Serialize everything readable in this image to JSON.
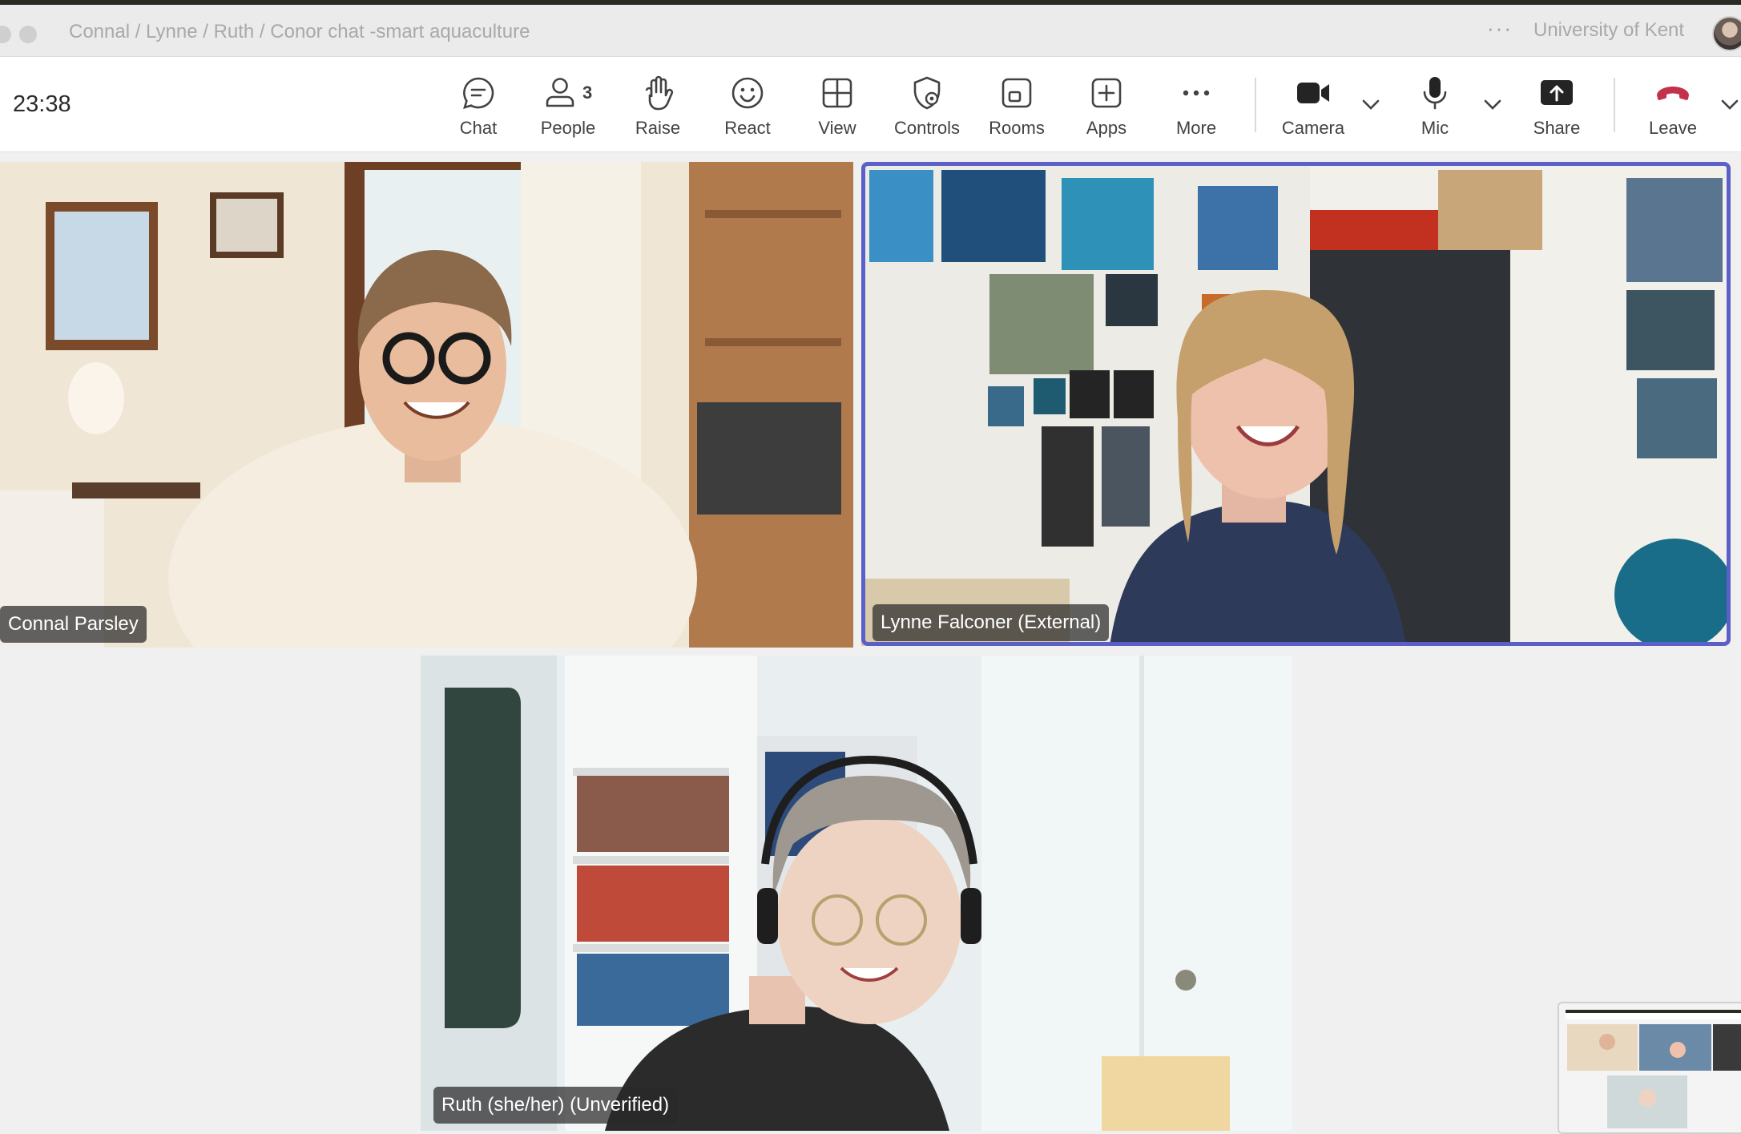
{
  "window": {
    "title": "Connal / Lynne / Ruth / Conor chat -smart aquaculture",
    "more_icon": "more-horizontal-icon",
    "organization": "University of Kent"
  },
  "toolbar": {
    "timer": "23:38",
    "buttons": {
      "chat": {
        "label": "Chat",
        "icon": "chat-bubble-icon"
      },
      "people": {
        "label": "People",
        "count": "3",
        "icon": "person-icon"
      },
      "raise": {
        "label": "Raise",
        "icon": "raise-hand-icon"
      },
      "react": {
        "label": "React",
        "icon": "smiley-icon"
      },
      "view": {
        "label": "View",
        "icon": "grid-view-icon"
      },
      "controls": {
        "label": "Controls",
        "icon": "shield-gear-icon"
      },
      "rooms": {
        "label": "Rooms",
        "icon": "breakout-rooms-icon"
      },
      "apps": {
        "label": "Apps",
        "icon": "add-app-icon"
      },
      "more": {
        "label": "More",
        "icon": "more-horizontal-icon"
      },
      "camera": {
        "label": "Camera",
        "icon": "video-camera-icon"
      },
      "mic": {
        "label": "Mic",
        "icon": "microphone-icon"
      },
      "share": {
        "label": "Share",
        "icon": "share-screen-icon"
      },
      "leave": {
        "label": "Leave",
        "icon": "hang-up-phone-icon",
        "color": "#c4314b"
      }
    }
  },
  "participants": [
    {
      "name": "Connal Parsley",
      "speaking": false
    },
    {
      "name": "Lynne Falconer (External)",
      "speaking": true
    },
    {
      "name": "Ruth (she/her) (Unverified)",
      "speaking": false
    }
  ],
  "colors": {
    "accent": "#5b5fc7",
    "leave_red": "#c4314b",
    "toolbar_bg": "#ffffff",
    "stage_bg": "#f0f0f0"
  }
}
